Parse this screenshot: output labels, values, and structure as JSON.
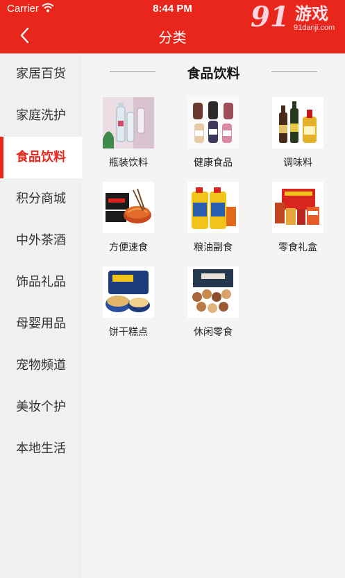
{
  "status_bar": {
    "carrier": "Carrier",
    "time": "8:44 PM"
  },
  "watermark": {
    "number": "91",
    "text": "游戏",
    "url": "91danji.com"
  },
  "nav": {
    "title": "分类",
    "back_icon": "chevron-left-icon"
  },
  "sidebar": {
    "items": [
      {
        "label": "家居百货"
      },
      {
        "label": "家庭洗护"
      },
      {
        "label": "食品饮料"
      },
      {
        "label": "积分商城"
      },
      {
        "label": "中外茶酒"
      },
      {
        "label": "饰品礼品"
      },
      {
        "label": "母婴用品"
      },
      {
        "label": "宠物频道"
      },
      {
        "label": "美妆个护"
      },
      {
        "label": "本地生活"
      }
    ],
    "active_index": 2
  },
  "main": {
    "section_title": "食品饮料",
    "categories": [
      {
        "label": "瓶装饮料",
        "icon": "bottled-drinks-image"
      },
      {
        "label": "健康食品",
        "icon": "health-food-image"
      },
      {
        "label": "调味料",
        "icon": "condiments-image"
      },
      {
        "label": "方便速食",
        "icon": "instant-noodles-image"
      },
      {
        "label": "粮油副食",
        "icon": "cooking-oil-image"
      },
      {
        "label": "零食礼盒",
        "icon": "snack-gift-box-image"
      },
      {
        "label": "饼干糕点",
        "icon": "cookies-image"
      },
      {
        "label": "休闲零食",
        "icon": "nuts-snacks-image"
      }
    ]
  },
  "colors": {
    "brand_red": "#e8261b",
    "sidebar_bg": "#f0f0f0",
    "content_bg": "#f4f4f4"
  }
}
